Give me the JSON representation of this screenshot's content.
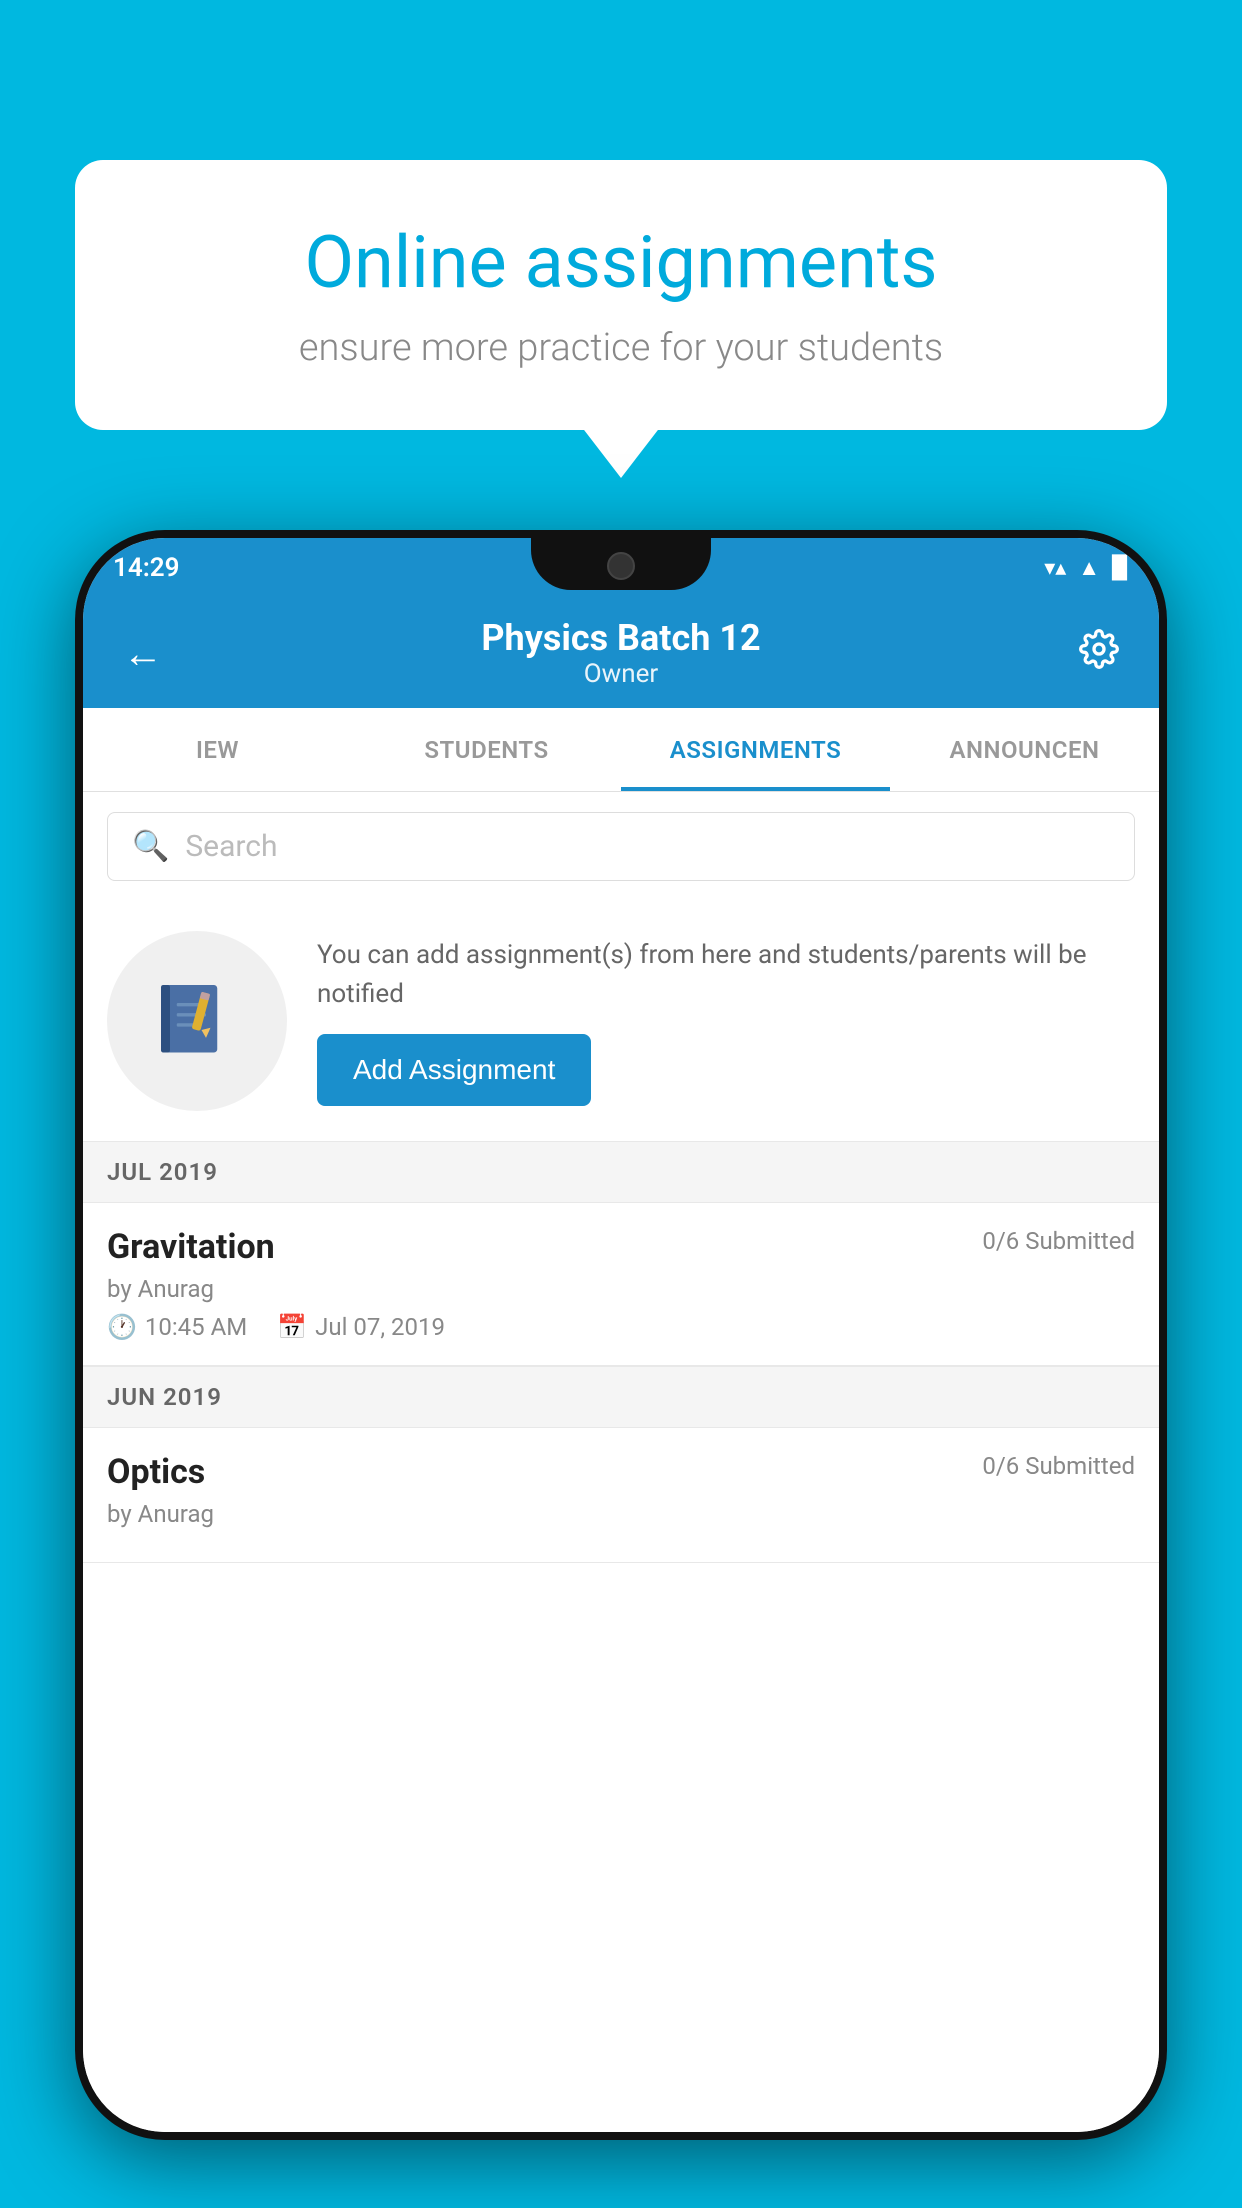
{
  "background_color": "#00b8e0",
  "speech_bubble": {
    "title": "Online assignments",
    "subtitle": "ensure more practice for your students"
  },
  "phone": {
    "status_bar": {
      "time": "14:29",
      "wifi": "▼",
      "signal": "▲",
      "battery": "▉"
    },
    "app_bar": {
      "title": "Physics Batch 12",
      "subtitle": "Owner",
      "back_label": "←",
      "settings_label": "⚙"
    },
    "tabs": [
      {
        "label": "IEW",
        "active": false
      },
      {
        "label": "STUDENTS",
        "active": false
      },
      {
        "label": "ASSIGNMENTS",
        "active": true
      },
      {
        "label": "ANNOUNCEN",
        "active": false
      }
    ],
    "search": {
      "placeholder": "Search"
    },
    "promo": {
      "description": "You can add assignment(s) from here and students/parents will be notified",
      "button_label": "Add Assignment"
    },
    "sections": [
      {
        "month_label": "JUL 2019",
        "assignments": [
          {
            "title": "Gravitation",
            "status": "0/6 Submitted",
            "by": "by Anurag",
            "time": "10:45 AM",
            "date": "Jul 07, 2019"
          }
        ]
      },
      {
        "month_label": "JUN 2019",
        "assignments": [
          {
            "title": "Optics",
            "status": "0/6 Submitted",
            "by": "by Anurag",
            "time": "",
            "date": ""
          }
        ]
      }
    ]
  }
}
